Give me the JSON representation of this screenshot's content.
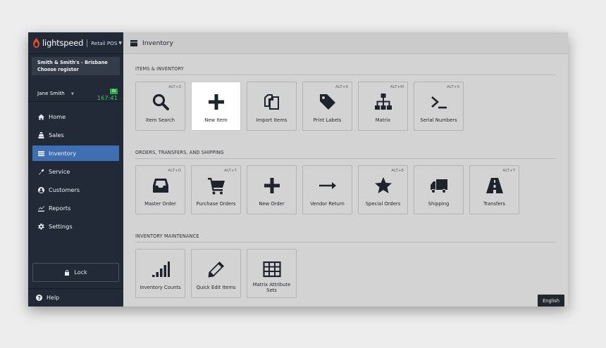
{
  "brand": {
    "name": "lightspeed",
    "product": "Retail POS",
    "accent": "#e24c2f"
  },
  "store": {
    "line1": "Smith & Smith's - Brisbane",
    "line2": "Choose register"
  },
  "user": {
    "name": "Jane Smith",
    "clock_badge": "IN",
    "clock_time": "167:41"
  },
  "nav": [
    {
      "id": "home",
      "label": "Home",
      "icon": "home-icon",
      "active": false
    },
    {
      "id": "sales",
      "label": "Sales",
      "icon": "register-icon",
      "active": false
    },
    {
      "id": "inventory",
      "label": "Inventory",
      "icon": "inventory-icon",
      "active": true
    },
    {
      "id": "service",
      "label": "Service",
      "icon": "wrench-icon",
      "active": false
    },
    {
      "id": "customers",
      "label": "Customers",
      "icon": "user-icon",
      "active": false
    },
    {
      "id": "reports",
      "label": "Reports",
      "icon": "chart-icon",
      "active": false
    },
    {
      "id": "settings",
      "label": "Settings",
      "icon": "gear-icon",
      "active": false
    }
  ],
  "lock_label": "Lock",
  "help_label": "Help",
  "header": {
    "title": "Inventory"
  },
  "sections": [
    {
      "title": "ITEMS & INVENTORY",
      "tiles": [
        {
          "label": "Item Search",
          "shortcut": "ALT+3",
          "icon": "search-icon"
        },
        {
          "label": "New Item",
          "shortcut": "",
          "icon": "plus-icon",
          "highlight": true
        },
        {
          "label": "Import Items",
          "shortcut": "",
          "icon": "copy-icon"
        },
        {
          "label": "Print Labels",
          "shortcut": "ALT+9",
          "icon": "tag-icon"
        },
        {
          "label": "Matrix",
          "shortcut": "ALT+M",
          "icon": "hierarchy-icon"
        },
        {
          "label": "Serial Numbers",
          "shortcut": "ALT+S",
          "icon": "terminal-icon"
        }
      ]
    },
    {
      "title": "ORDERS, TRANSFERS, AND SHIPPING",
      "tiles": [
        {
          "label": "Master Order",
          "shortcut": "ALT+O",
          "icon": "inbox-icon"
        },
        {
          "label": "Purchase Orders",
          "shortcut": "ALT+7",
          "icon": "cart-icon"
        },
        {
          "label": "New Order",
          "shortcut": "",
          "icon": "plus-icon"
        },
        {
          "label": "Vendor Return",
          "shortcut": "",
          "icon": "arrow-right-icon"
        },
        {
          "label": "Special Orders",
          "shortcut": "ALT+8",
          "icon": "star-icon"
        },
        {
          "label": "Shipping",
          "shortcut": "",
          "icon": "truck-icon"
        },
        {
          "label": "Transfers",
          "shortcut": "ALT+T",
          "icon": "road-icon"
        }
      ]
    },
    {
      "title": "INVENTORY MAINTENANCE",
      "tiles": [
        {
          "label": "Inventory Counts",
          "shortcut": "",
          "icon": "signal-bars-icon"
        },
        {
          "label": "Quick Edit Items",
          "shortcut": "",
          "icon": "pencil-icon"
        },
        {
          "label": "Matrix Attribute Sets",
          "shortcut": "",
          "icon": "table-icon"
        }
      ]
    }
  ],
  "language": "English"
}
